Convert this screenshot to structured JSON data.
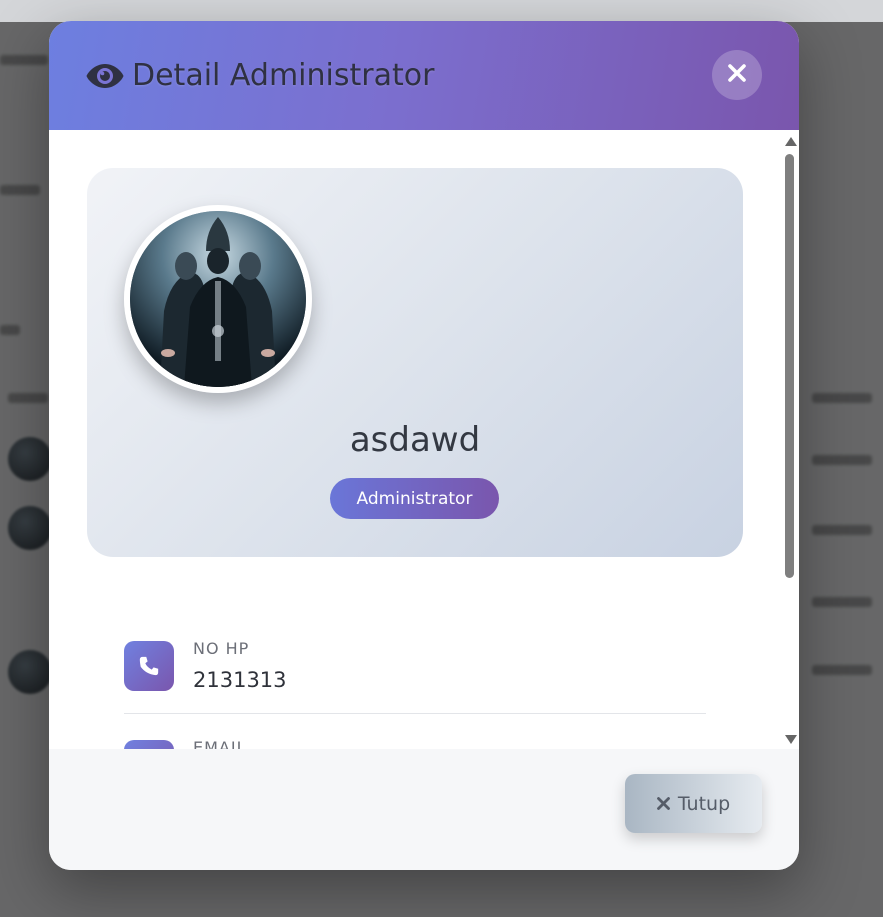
{
  "modal": {
    "title": "Detail Administrator",
    "close_icon": "close-icon",
    "header_icon": "eye-icon"
  },
  "profile": {
    "name": "asdawd",
    "role": "Administrator"
  },
  "fields": {
    "phone": {
      "label": "NO HP",
      "value": "2131313",
      "icon": "phone-icon"
    },
    "email": {
      "label": "EMAIL",
      "value": "",
      "icon": "envelope-icon"
    }
  },
  "footer": {
    "close_label": "Tutup"
  },
  "colors": {
    "header_start": "#6d7fe0",
    "header_end": "#7a56ad",
    "accent": "#7a56ad"
  }
}
